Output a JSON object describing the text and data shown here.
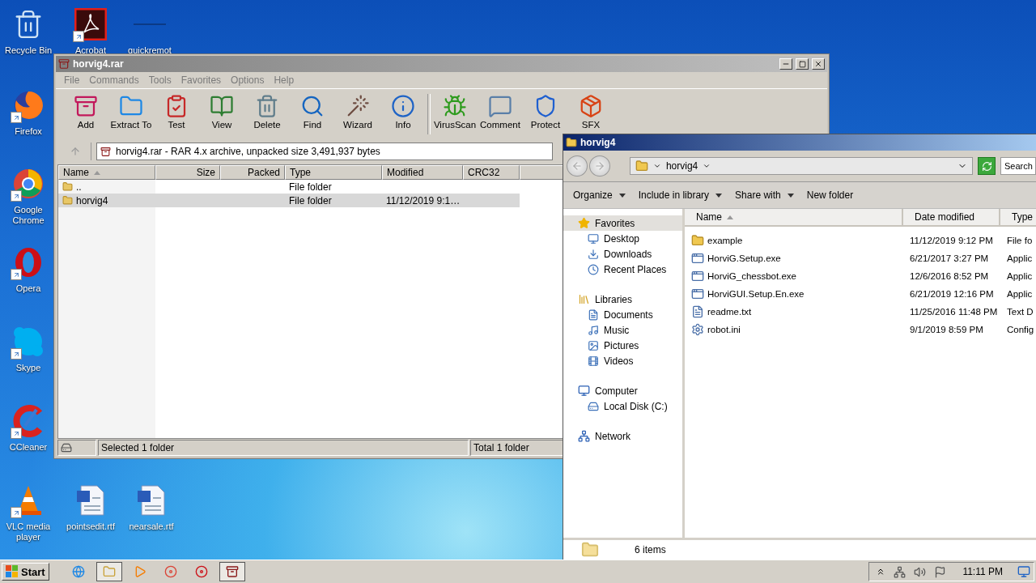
{
  "desktop_icons": [
    {
      "label": "Recycle Bin",
      "shortcut": false
    },
    {
      "label": "Acrobat",
      "shortcut": true
    },
    {
      "label": "quickremot",
      "shortcut": false
    },
    {
      "label": "Firefox",
      "shortcut": true
    },
    {
      "label": "Google Chrome",
      "shortcut": true
    },
    {
      "label": "Opera",
      "shortcut": true
    },
    {
      "label": "Skype",
      "shortcut": true
    },
    {
      "label": "CCleaner",
      "shortcut": true
    },
    {
      "label": "VLC media player",
      "shortcut": true
    },
    {
      "label": "pointsedit.rtf",
      "shortcut": false
    },
    {
      "label": "nearsale.rtf",
      "shortcut": false
    }
  ],
  "winrar": {
    "title": "horvig4.rar",
    "menu": [
      "File",
      "Commands",
      "Tools",
      "Favorites",
      "Options",
      "Help"
    ],
    "toolbar": [
      "Add",
      "Extract To",
      "Test",
      "View",
      "Delete",
      "Find",
      "Wizard",
      "Info",
      "VirusScan",
      "Comment",
      "Protect",
      "SFX"
    ],
    "address": "horvig4.rar - RAR 4.x archive, unpacked size 3,491,937 bytes",
    "columns": [
      {
        "label": "Name",
        "sorted": true
      },
      {
        "label": "Size",
        "sorted": false
      },
      {
        "label": "Packed",
        "sorted": false
      },
      {
        "label": "Type",
        "sorted": false
      },
      {
        "label": "Modified",
        "sorted": false
      },
      {
        "label": "CRC32",
        "sorted": false
      }
    ],
    "rows": [
      {
        "name": "..",
        "type": "File folder",
        "selected": false
      },
      {
        "name": "horvig4",
        "type": "File folder",
        "modified": "11/12/2019 9:1…",
        "selected": true
      }
    ],
    "status": {
      "left": "Selected 1 folder",
      "right": "Total 1 folder"
    }
  },
  "explorer": {
    "title": "horvig4",
    "address": "horvig4",
    "search": {
      "placeholder": "Search"
    },
    "commands": [
      {
        "label": "Organize",
        "dropdown": true
      },
      {
        "label": "Include in library",
        "dropdown": true
      },
      {
        "label": "Share with",
        "dropdown": true
      },
      {
        "label": "New folder",
        "dropdown": false
      }
    ],
    "nav": [
      {
        "label": "Favorites",
        "selected": true,
        "children": [
          {
            "label": "Desktop"
          },
          {
            "label": "Downloads"
          },
          {
            "label": "Recent Places"
          }
        ]
      },
      {
        "label": "Libraries",
        "selected": false,
        "children": [
          {
            "label": "Documents"
          },
          {
            "label": "Music"
          },
          {
            "label": "Pictures"
          },
          {
            "label": "Videos"
          }
        ]
      },
      {
        "label": "Computer",
        "selected": false,
        "children": [
          {
            "label": "Local Disk (C:)"
          }
        ]
      },
      {
        "label": "Network",
        "selected": false
      }
    ],
    "columns": [
      {
        "label": "Name",
        "sorted": true
      },
      {
        "label": "Date modified",
        "sorted": false
      },
      {
        "label": "Type",
        "sorted": false
      }
    ],
    "files": [
      {
        "name": "example",
        "modified": "11/12/2019 9:12 PM",
        "type": "File fo"
      },
      {
        "name": "HorviG.Setup.exe",
        "modified": "6/21/2017 3:27 PM",
        "type": "Applic"
      },
      {
        "name": "HorviG_chessbot.exe",
        "modified": "12/6/2016 8:52 PM",
        "type": "Applic"
      },
      {
        "name": "HorviGUI.Setup.En.exe",
        "modified": "6/21/2019 12:16 PM",
        "type": "Applic"
      },
      {
        "name": "readme.txt",
        "modified": "11/25/2016 11:48 PM",
        "type": "Text D"
      },
      {
        "name": "robot.ini",
        "modified": "9/1/2019 8:59 PM",
        "type": "Config"
      }
    ],
    "status": "6 items"
  },
  "taskbar": {
    "start": "Start",
    "apps": [
      {
        "active": false
      },
      {
        "active": true
      },
      {
        "active": false
      },
      {
        "active": false
      },
      {
        "active": false
      },
      {
        "active": true
      }
    ],
    "clock": "11:11 PM"
  }
}
